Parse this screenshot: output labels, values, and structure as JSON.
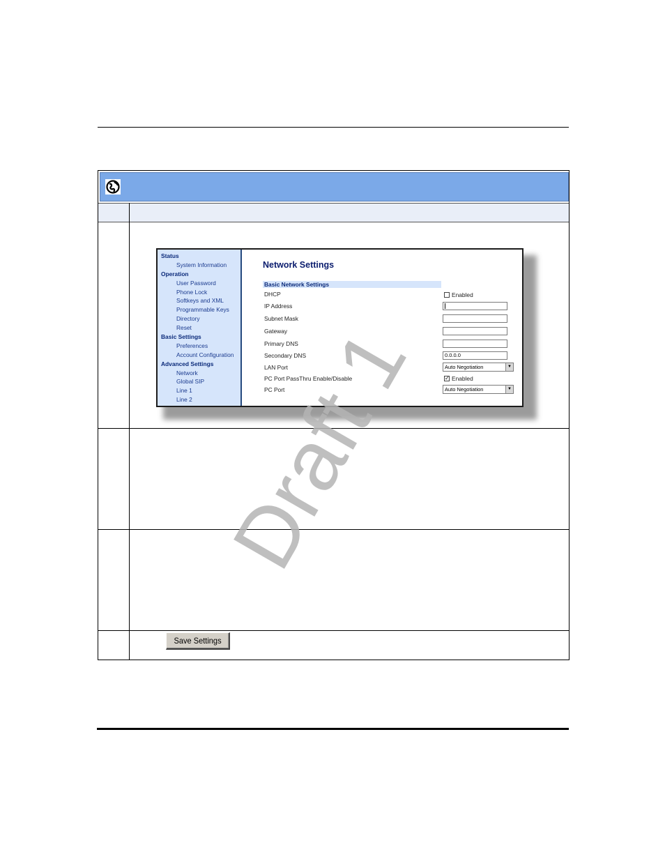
{
  "sidebar": {
    "groups": [
      {
        "label": "Status",
        "items": [
          "System Information"
        ]
      },
      {
        "label": "Operation",
        "items": [
          "User Password",
          "Phone Lock",
          "Softkeys and XML",
          "Programmable Keys",
          "Directory",
          "Reset"
        ]
      },
      {
        "label": "Basic Settings",
        "items": [
          "Preferences",
          "Account Configuration"
        ]
      },
      {
        "label": "Advanced Settings",
        "items": [
          "Network",
          "Global SIP",
          "Line 1",
          "Line 2"
        ]
      }
    ]
  },
  "network": {
    "title": "Network Settings",
    "section": "Basic Network Settings",
    "dhcp_label": "DHCP",
    "dhcp_checkbox_label": "Enabled",
    "dhcp_checked": false,
    "ip_label": "IP Address",
    "ip_value": "",
    "subnet_label": "Subnet Mask",
    "subnet_value": "",
    "gateway_label": "Gateway",
    "gateway_value": "",
    "primary_dns_label": "Primary DNS",
    "primary_dns_value": "",
    "secondary_dns_label": "Secondary DNS",
    "secondary_dns_value": "0.0.0.0",
    "lan_port_label": "LAN Port",
    "lan_port_value": "Auto Negotiation",
    "passthru_label": "PC Port PassThru Enable/Disable",
    "passthru_checkbox_label": "Enabled",
    "passthru_checked": true,
    "pc_port_label": "PC Port",
    "pc_port_value": "Auto Negotiation"
  },
  "save_button_label": "Save Settings",
  "watermark": "Draft 1",
  "colors": {
    "header_bar": "#7ba9e8",
    "sidebar_bg": "#d6e5fb",
    "link": "#1b3b8f"
  }
}
